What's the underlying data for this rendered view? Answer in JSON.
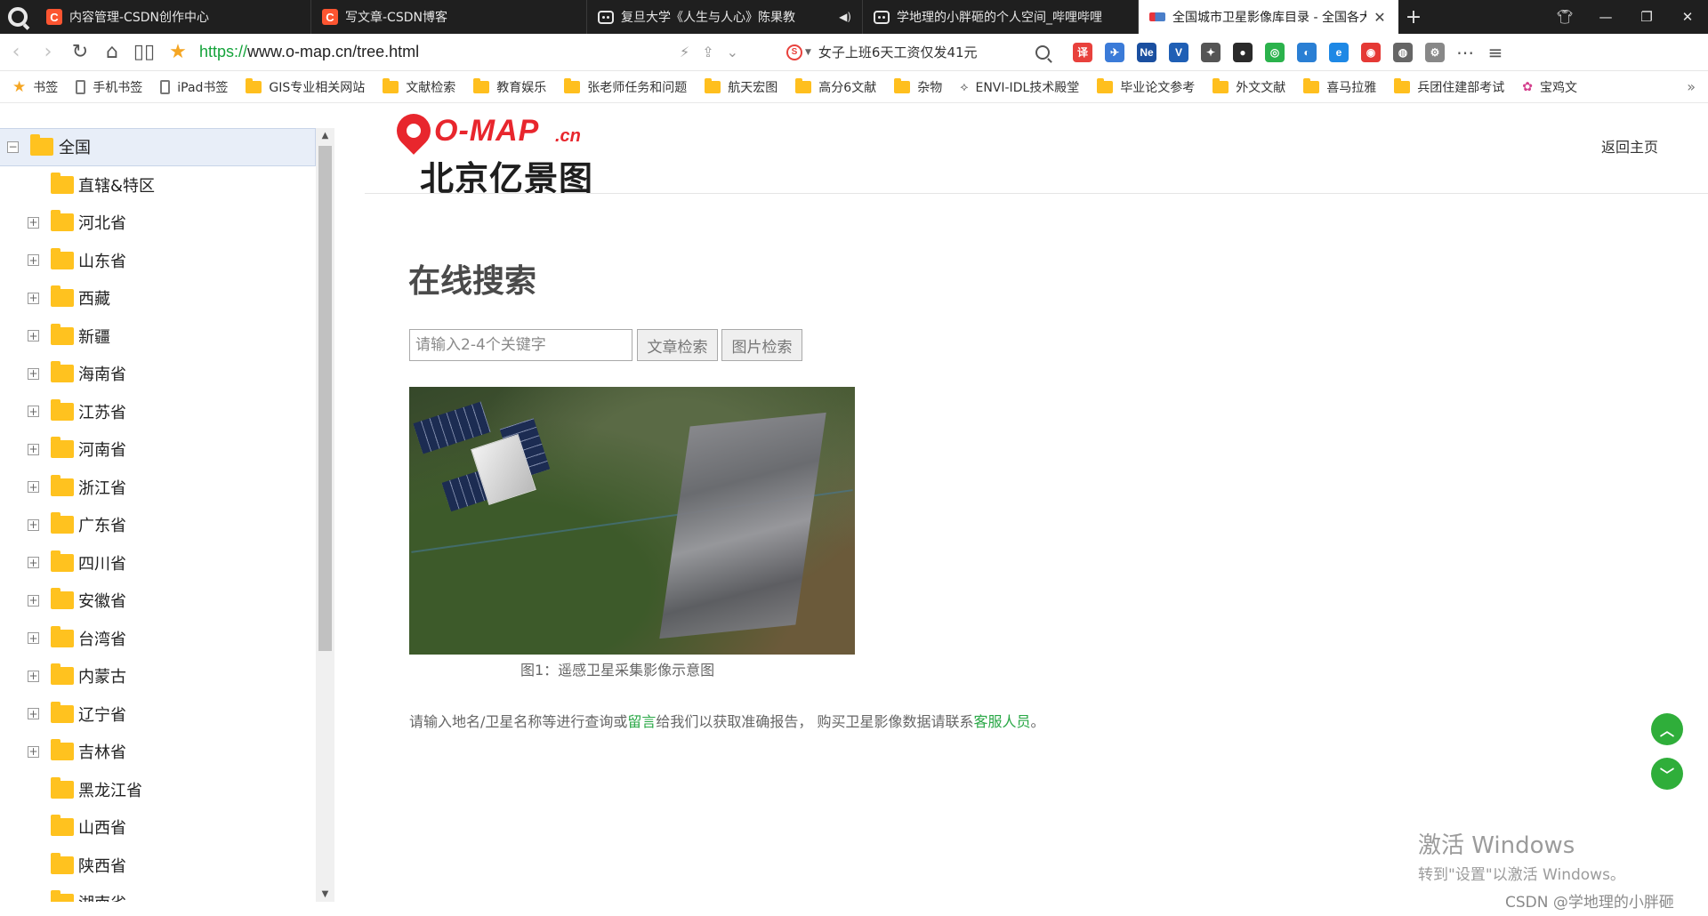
{
  "tabs": [
    {
      "title": "内容管理-CSDN创作中心",
      "favicon": "csdn-icon",
      "active": false,
      "muted": false
    },
    {
      "title": "写文章-CSDN博客",
      "favicon": "csdn-icon",
      "active": false,
      "muted": false
    },
    {
      "title": "复旦大学《人生与人心》陈果教",
      "favicon": "bilibili-icon",
      "active": false,
      "audio": true
    },
    {
      "title": "学地理的小胖砸的个人空间_哔哩哔哩",
      "favicon": "bilibili-icon",
      "active": false
    },
    {
      "title": "全国城市卫星影像库目录 - 全国各大",
      "favicon": "omap-icon",
      "active": true
    }
  ],
  "address_bar": {
    "url_scheme": "https://",
    "url_rest": "www.o-map.cn/tree.html",
    "search_text": "女子上班6天工资仅发41元"
  },
  "bookmarks": [
    {
      "label": "书签",
      "icon": "star-icon"
    },
    {
      "label": "手机书签",
      "icon": "phone-icon"
    },
    {
      "label": "iPad书签",
      "icon": "phone-icon"
    },
    {
      "label": "GIS专业相关网站",
      "icon": "folder-icon"
    },
    {
      "label": "文献检索",
      "icon": "folder-icon"
    },
    {
      "label": "教育娱乐",
      "icon": "folder-icon"
    },
    {
      "label": "张老师任务和问题",
      "icon": "folder-icon"
    },
    {
      "label": "航天宏图",
      "icon": "folder-icon"
    },
    {
      "label": "高分6文献",
      "icon": "folder-icon"
    },
    {
      "label": "杂物",
      "icon": "folder-icon"
    },
    {
      "label": "ENVI-IDL技术殿堂",
      "icon": "link-icon"
    },
    {
      "label": "毕业论文参考",
      "icon": "folder-icon"
    },
    {
      "label": "外文文献",
      "icon": "folder-icon"
    },
    {
      "label": "喜马拉雅",
      "icon": "folder-icon"
    },
    {
      "label": "兵团住建部考试",
      "icon": "folder-icon"
    },
    {
      "label": "宝鸡文",
      "icon": "colorful-icon"
    }
  ],
  "extensions": [
    {
      "glyph": "译",
      "color": "#e8413c"
    },
    {
      "glyph": "✈",
      "color": "#3b7bd8"
    },
    {
      "glyph": "Ne",
      "color": "#1a4fa0"
    },
    {
      "glyph": "V",
      "color": "#1f5fb5"
    },
    {
      "glyph": "✦",
      "color": "#555555"
    },
    {
      "glyph": "●",
      "color": "#2a2a2a"
    },
    {
      "glyph": "◎",
      "color": "#2bb24c"
    },
    {
      "glyph": "◐",
      "color": "#2a7fd4"
    },
    {
      "glyph": "e",
      "color": "#1e88e5"
    },
    {
      "glyph": "◉",
      "color": "#e53935"
    },
    {
      "glyph": "◍",
      "color": "#666666"
    },
    {
      "glyph": "⚙",
      "color": "#888888"
    }
  ],
  "tree": {
    "root": "全国",
    "items": [
      {
        "label": "直辖&特区",
        "expandable": false
      },
      {
        "label": "河北省",
        "expandable": true
      },
      {
        "label": "山东省",
        "expandable": true
      },
      {
        "label": "西藏",
        "expandable": true
      },
      {
        "label": "新疆",
        "expandable": true
      },
      {
        "label": "海南省",
        "expandable": true
      },
      {
        "label": "江苏省",
        "expandable": true
      },
      {
        "label": "河南省",
        "expandable": true
      },
      {
        "label": "浙江省",
        "expandable": true
      },
      {
        "label": "广东省",
        "expandable": true
      },
      {
        "label": "四川省",
        "expandable": true
      },
      {
        "label": "安徽省",
        "expandable": true
      },
      {
        "label": "台湾省",
        "expandable": true
      },
      {
        "label": "内蒙古",
        "expandable": true
      },
      {
        "label": "辽宁省",
        "expandable": true
      },
      {
        "label": "吉林省",
        "expandable": true
      },
      {
        "label": "黑龙江省",
        "expandable": false
      },
      {
        "label": "山西省",
        "expandable": false
      },
      {
        "label": "陕西省",
        "expandable": false
      },
      {
        "label": "湖南省",
        "expandable": false
      }
    ]
  },
  "site": {
    "logo_word": "O-MAP",
    "logo_tld": ".cn",
    "logo_company": "北京亿景图",
    "back_home": "返回主页"
  },
  "search": {
    "title": "在线搜索",
    "placeholder": "请输入2-4个关键字",
    "article_button": "文章检索",
    "image_button": "图片检索"
  },
  "figure": {
    "caption": "图1：遥感卫星采集影像示意图"
  },
  "note": {
    "text_a": "请输入地名/卫星名称等进行查询或",
    "link_a": "留言",
    "text_b": "给我们以获取准确报告，  购买卫星影像数据请联系",
    "link_b": "客服人员",
    "text_c": "。"
  },
  "overlay": {
    "win_line1": "激活 Windows",
    "win_line2": "转到\"设置\"以激活 Windows。",
    "csdn": "CSDN @学地理的小胖砸"
  }
}
